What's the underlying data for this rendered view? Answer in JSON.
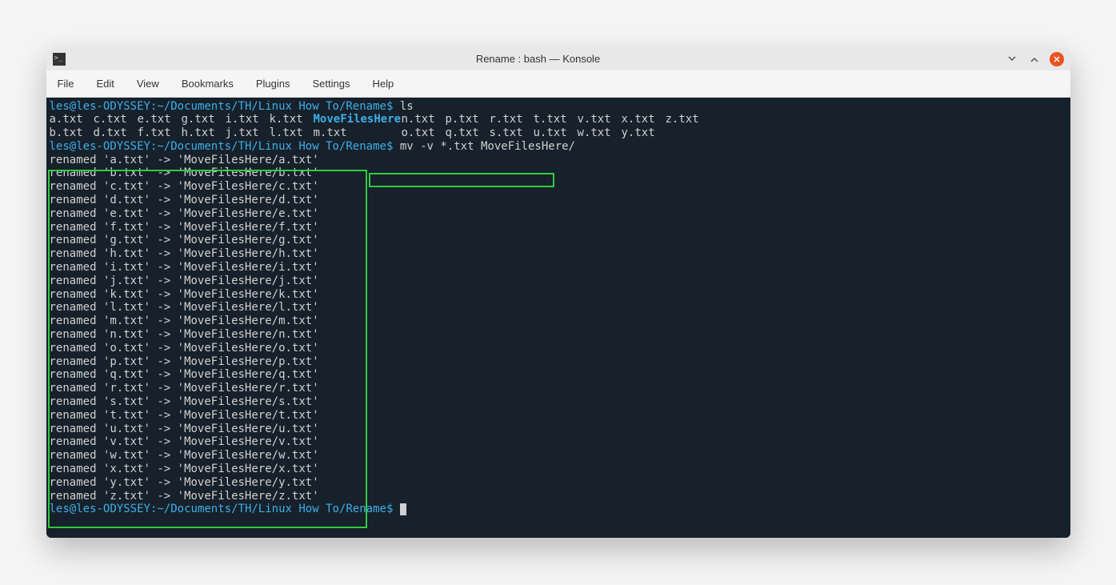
{
  "window": {
    "title": "Rename : bash — Konsole"
  },
  "menu": {
    "items": [
      "File",
      "Edit",
      "View",
      "Bookmarks",
      "Plugins",
      "Settings",
      "Help"
    ]
  },
  "prompt": {
    "userhost": "les@les-ODYSSEY",
    "path": "~/Documents/TH/Linux How To/Rename",
    "dollar": "$"
  },
  "commands": {
    "cmd1": "ls",
    "cmd2": "mv -v *.txt MoveFilesHere/"
  },
  "ls_output": {
    "dir": "MoveFilesHere",
    "row1_left": [
      "a.txt",
      "c.txt",
      "e.txt",
      "g.txt",
      "i.txt",
      "k.txt"
    ],
    "row1_right": [
      "n.txt",
      "p.txt",
      "r.txt",
      "t.txt",
      "v.txt",
      "x.txt",
      "z.txt"
    ],
    "row2_left": [
      "b.txt",
      "d.txt",
      "f.txt",
      "h.txt",
      "j.txt",
      "l.txt"
    ],
    "row2_mid": "m.txt",
    "row2_right": [
      "o.txt",
      "q.txt",
      "s.txt",
      "u.txt",
      "w.txt",
      "y.txt"
    ]
  },
  "renamed": [
    "renamed 'a.txt' -> 'MoveFilesHere/a.txt'",
    "renamed 'b.txt' -> 'MoveFilesHere/b.txt'",
    "renamed 'c.txt' -> 'MoveFilesHere/c.txt'",
    "renamed 'd.txt' -> 'MoveFilesHere/d.txt'",
    "renamed 'e.txt' -> 'MoveFilesHere/e.txt'",
    "renamed 'f.txt' -> 'MoveFilesHere/f.txt'",
    "renamed 'g.txt' -> 'MoveFilesHere/g.txt'",
    "renamed 'h.txt' -> 'MoveFilesHere/h.txt'",
    "renamed 'i.txt' -> 'MoveFilesHere/i.txt'",
    "renamed 'j.txt' -> 'MoveFilesHere/j.txt'",
    "renamed 'k.txt' -> 'MoveFilesHere/k.txt'",
    "renamed 'l.txt' -> 'MoveFilesHere/l.txt'",
    "renamed 'm.txt' -> 'MoveFilesHere/m.txt'",
    "renamed 'n.txt' -> 'MoveFilesHere/n.txt'",
    "renamed 'o.txt' -> 'MoveFilesHere/o.txt'",
    "renamed 'p.txt' -> 'MoveFilesHere/p.txt'",
    "renamed 'q.txt' -> 'MoveFilesHere/q.txt'",
    "renamed 'r.txt' -> 'MoveFilesHere/r.txt'",
    "renamed 's.txt' -> 'MoveFilesHere/s.txt'",
    "renamed 't.txt' -> 'MoveFilesHere/t.txt'",
    "renamed 'u.txt' -> 'MoveFilesHere/u.txt'",
    "renamed 'v.txt' -> 'MoveFilesHere/v.txt'",
    "renamed 'w.txt' -> 'MoveFilesHere/w.txt'",
    "renamed 'x.txt' -> 'MoveFilesHere/x.txt'",
    "renamed 'y.txt' -> 'MoveFilesHere/y.txt'",
    "renamed 'z.txt' -> 'MoveFilesHere/z.txt'"
  ]
}
